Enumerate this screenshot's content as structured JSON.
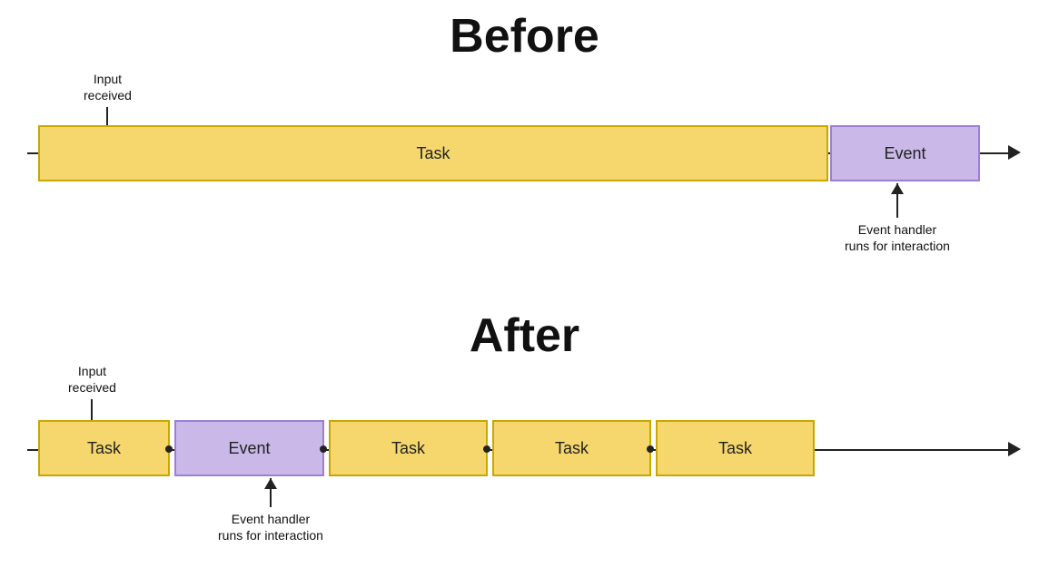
{
  "before": {
    "title": "Before",
    "annotation_input": "Input\nreceived",
    "annotation_event": "Event handler\nruns for interaction",
    "task_label": "Task",
    "event_label": "Event"
  },
  "after": {
    "title": "After",
    "annotation_input": "Input\nreceived",
    "annotation_event": "Event handler\nruns for interaction",
    "task_label": "Task",
    "event_label": "Event",
    "task2_label": "Task",
    "task3_label": "Task",
    "task4_label": "Task"
  }
}
